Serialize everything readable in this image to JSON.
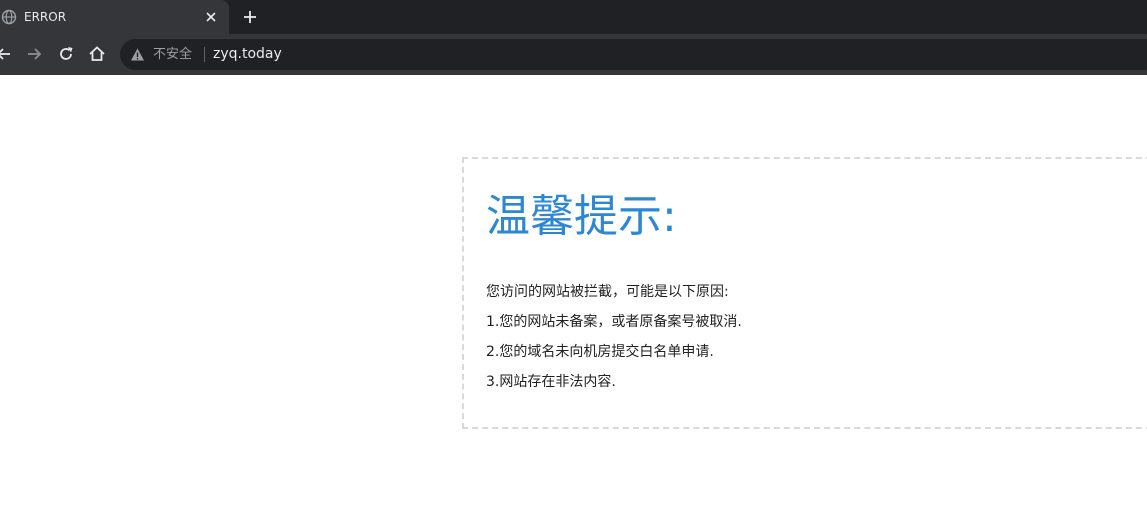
{
  "tab": {
    "favicon": "globe-icon",
    "title": "ERROR",
    "close_icon": "close-icon"
  },
  "new_tab_icon": "plus-icon",
  "toolbar": {
    "back_icon": "arrow-left-icon",
    "forward_icon": "arrow-right-icon",
    "reload_icon": "reload-icon",
    "home_icon": "home-icon"
  },
  "omnibox": {
    "security_icon": "warning-triangle-icon",
    "security_label": "不安全",
    "url": "zyq.today"
  },
  "notice": {
    "title": "温馨提示:",
    "lines": [
      "您访问的网站被拦截，可能是以下原因:",
      "1.您的网站未备案，或者原备案号被取消.",
      "2.您的域名未向机房提交白名单申请.",
      "3.网站存在非法内容."
    ]
  },
  "colors": {
    "tabstrip": "#202124",
    "toolbar": "#35363a",
    "title_blue": "#2d87d2",
    "border_dashed": "#d9d9d9"
  }
}
